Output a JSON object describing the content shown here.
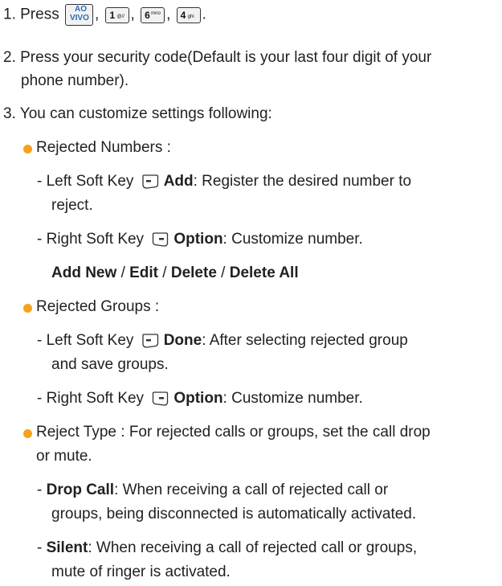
{
  "colors": {
    "bullet": "#f7a21b",
    "text": "#231f20"
  },
  "step1": {
    "prefix": "1. Press ",
    "keys": [
      {
        "top": "AO",
        "bottom": "VIVO"
      },
      {
        "main": "1",
        "sub": "@//"
      },
      {
        "main": "6",
        "sub": "mno"
      },
      {
        "main": "4",
        "sub": "ghi"
      }
    ],
    "sep": ",",
    "end": "."
  },
  "step2": {
    "line1": "2. Press your security code(Default is your last four digit of your",
    "line2": "phone number)."
  },
  "step3": {
    "text": "3. You can customize settings following:"
  },
  "rejected_numbers": {
    "title": "Rejected Numbers :",
    "left": {
      "prefix": "- Left Soft Key",
      "bold": "Add",
      "rest": ": Register the desired number to",
      "cont": "reject."
    },
    "right": {
      "prefix": "- Right Soft Key",
      "bold": "Option",
      "rest": ": Customize number."
    },
    "options": [
      "Add New",
      "Edit",
      "Delete",
      "Delete All"
    ],
    "options_sep": "/"
  },
  "rejected_groups": {
    "title": "Rejected Groups :",
    "left": {
      "prefix": "- Left Soft Key",
      "bold": "Done",
      "rest": ": After selecting rejected group",
      "cont": "and save groups."
    },
    "right": {
      "prefix": "- Right Soft Key",
      "bold": "Option",
      "rest": ": Customize number."
    }
  },
  "reject_type": {
    "line1": "Reject Type : For rejected calls or groups, set the call drop",
    "line2": "or mute.",
    "drop": {
      "prefix": "- ",
      "bold": "Drop Call",
      "rest": ": When receiving a call of rejected call or",
      "cont": "groups, being disconnected is automatically activated."
    },
    "silent": {
      "prefix": "- ",
      "bold": "Silent",
      "rest": ": When receiving a call of rejected call or groups,",
      "cont": "mute of ringer is activated."
    }
  }
}
